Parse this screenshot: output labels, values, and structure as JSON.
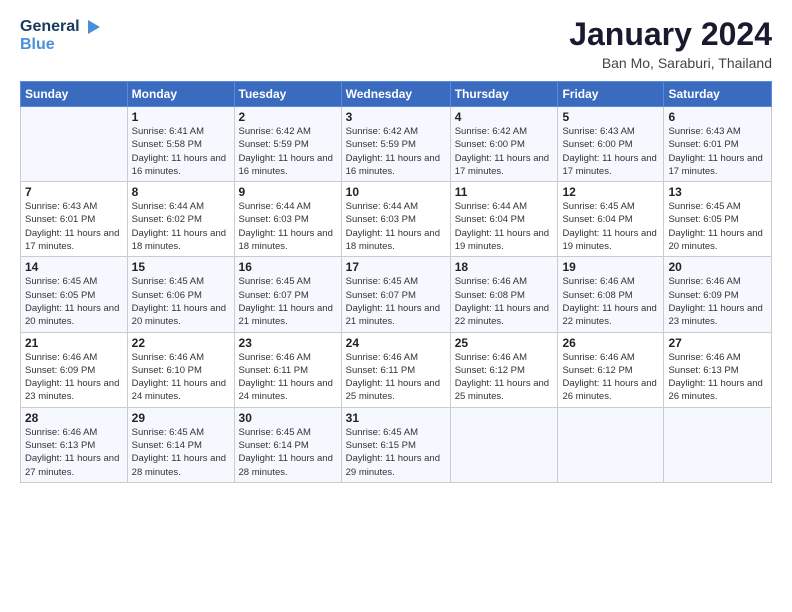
{
  "logo": {
    "text_general": "General",
    "text_blue": "Blue"
  },
  "header": {
    "month": "January 2024",
    "location": "Ban Mo, Saraburi, Thailand"
  },
  "weekdays": [
    "Sunday",
    "Monday",
    "Tuesday",
    "Wednesday",
    "Thursday",
    "Friday",
    "Saturday"
  ],
  "weeks": [
    [
      {
        "day": "",
        "sunrise": "",
        "sunset": "",
        "daylight": ""
      },
      {
        "day": "1",
        "sunrise": "Sunrise: 6:41 AM",
        "sunset": "Sunset: 5:58 PM",
        "daylight": "Daylight: 11 hours and 16 minutes."
      },
      {
        "day": "2",
        "sunrise": "Sunrise: 6:42 AM",
        "sunset": "Sunset: 5:59 PM",
        "daylight": "Daylight: 11 hours and 16 minutes."
      },
      {
        "day": "3",
        "sunrise": "Sunrise: 6:42 AM",
        "sunset": "Sunset: 5:59 PM",
        "daylight": "Daylight: 11 hours and 16 minutes."
      },
      {
        "day": "4",
        "sunrise": "Sunrise: 6:42 AM",
        "sunset": "Sunset: 6:00 PM",
        "daylight": "Daylight: 11 hours and 17 minutes."
      },
      {
        "day": "5",
        "sunrise": "Sunrise: 6:43 AM",
        "sunset": "Sunset: 6:00 PM",
        "daylight": "Daylight: 11 hours and 17 minutes."
      },
      {
        "day": "6",
        "sunrise": "Sunrise: 6:43 AM",
        "sunset": "Sunset: 6:01 PM",
        "daylight": "Daylight: 11 hours and 17 minutes."
      }
    ],
    [
      {
        "day": "7",
        "sunrise": "Sunrise: 6:43 AM",
        "sunset": "Sunset: 6:01 PM",
        "daylight": "Daylight: 11 hours and 17 minutes."
      },
      {
        "day": "8",
        "sunrise": "Sunrise: 6:44 AM",
        "sunset": "Sunset: 6:02 PM",
        "daylight": "Daylight: 11 hours and 18 minutes."
      },
      {
        "day": "9",
        "sunrise": "Sunrise: 6:44 AM",
        "sunset": "Sunset: 6:03 PM",
        "daylight": "Daylight: 11 hours and 18 minutes."
      },
      {
        "day": "10",
        "sunrise": "Sunrise: 6:44 AM",
        "sunset": "Sunset: 6:03 PM",
        "daylight": "Daylight: 11 hours and 18 minutes."
      },
      {
        "day": "11",
        "sunrise": "Sunrise: 6:44 AM",
        "sunset": "Sunset: 6:04 PM",
        "daylight": "Daylight: 11 hours and 19 minutes."
      },
      {
        "day": "12",
        "sunrise": "Sunrise: 6:45 AM",
        "sunset": "Sunset: 6:04 PM",
        "daylight": "Daylight: 11 hours and 19 minutes."
      },
      {
        "day": "13",
        "sunrise": "Sunrise: 6:45 AM",
        "sunset": "Sunset: 6:05 PM",
        "daylight": "Daylight: 11 hours and 20 minutes."
      }
    ],
    [
      {
        "day": "14",
        "sunrise": "Sunrise: 6:45 AM",
        "sunset": "Sunset: 6:05 PM",
        "daylight": "Daylight: 11 hours and 20 minutes."
      },
      {
        "day": "15",
        "sunrise": "Sunrise: 6:45 AM",
        "sunset": "Sunset: 6:06 PM",
        "daylight": "Daylight: 11 hours and 20 minutes."
      },
      {
        "day": "16",
        "sunrise": "Sunrise: 6:45 AM",
        "sunset": "Sunset: 6:07 PM",
        "daylight": "Daylight: 11 hours and 21 minutes."
      },
      {
        "day": "17",
        "sunrise": "Sunrise: 6:45 AM",
        "sunset": "Sunset: 6:07 PM",
        "daylight": "Daylight: 11 hours and 21 minutes."
      },
      {
        "day": "18",
        "sunrise": "Sunrise: 6:46 AM",
        "sunset": "Sunset: 6:08 PM",
        "daylight": "Daylight: 11 hours and 22 minutes."
      },
      {
        "day": "19",
        "sunrise": "Sunrise: 6:46 AM",
        "sunset": "Sunset: 6:08 PM",
        "daylight": "Daylight: 11 hours and 22 minutes."
      },
      {
        "day": "20",
        "sunrise": "Sunrise: 6:46 AM",
        "sunset": "Sunset: 6:09 PM",
        "daylight": "Daylight: 11 hours and 23 minutes."
      }
    ],
    [
      {
        "day": "21",
        "sunrise": "Sunrise: 6:46 AM",
        "sunset": "Sunset: 6:09 PM",
        "daylight": "Daylight: 11 hours and 23 minutes."
      },
      {
        "day": "22",
        "sunrise": "Sunrise: 6:46 AM",
        "sunset": "Sunset: 6:10 PM",
        "daylight": "Daylight: 11 hours and 24 minutes."
      },
      {
        "day": "23",
        "sunrise": "Sunrise: 6:46 AM",
        "sunset": "Sunset: 6:11 PM",
        "daylight": "Daylight: 11 hours and 24 minutes."
      },
      {
        "day": "24",
        "sunrise": "Sunrise: 6:46 AM",
        "sunset": "Sunset: 6:11 PM",
        "daylight": "Daylight: 11 hours and 25 minutes."
      },
      {
        "day": "25",
        "sunrise": "Sunrise: 6:46 AM",
        "sunset": "Sunset: 6:12 PM",
        "daylight": "Daylight: 11 hours and 25 minutes."
      },
      {
        "day": "26",
        "sunrise": "Sunrise: 6:46 AM",
        "sunset": "Sunset: 6:12 PM",
        "daylight": "Daylight: 11 hours and 26 minutes."
      },
      {
        "day": "27",
        "sunrise": "Sunrise: 6:46 AM",
        "sunset": "Sunset: 6:13 PM",
        "daylight": "Daylight: 11 hours and 26 minutes."
      }
    ],
    [
      {
        "day": "28",
        "sunrise": "Sunrise: 6:46 AM",
        "sunset": "Sunset: 6:13 PM",
        "daylight": "Daylight: 11 hours and 27 minutes."
      },
      {
        "day": "29",
        "sunrise": "Sunrise: 6:45 AM",
        "sunset": "Sunset: 6:14 PM",
        "daylight": "Daylight: 11 hours and 28 minutes."
      },
      {
        "day": "30",
        "sunrise": "Sunrise: 6:45 AM",
        "sunset": "Sunset: 6:14 PM",
        "daylight": "Daylight: 11 hours and 28 minutes."
      },
      {
        "day": "31",
        "sunrise": "Sunrise: 6:45 AM",
        "sunset": "Sunset: 6:15 PM",
        "daylight": "Daylight: 11 hours and 29 minutes."
      },
      {
        "day": "",
        "sunrise": "",
        "sunset": "",
        "daylight": ""
      },
      {
        "day": "",
        "sunrise": "",
        "sunset": "",
        "daylight": ""
      },
      {
        "day": "",
        "sunrise": "",
        "sunset": "",
        "daylight": ""
      }
    ]
  ]
}
